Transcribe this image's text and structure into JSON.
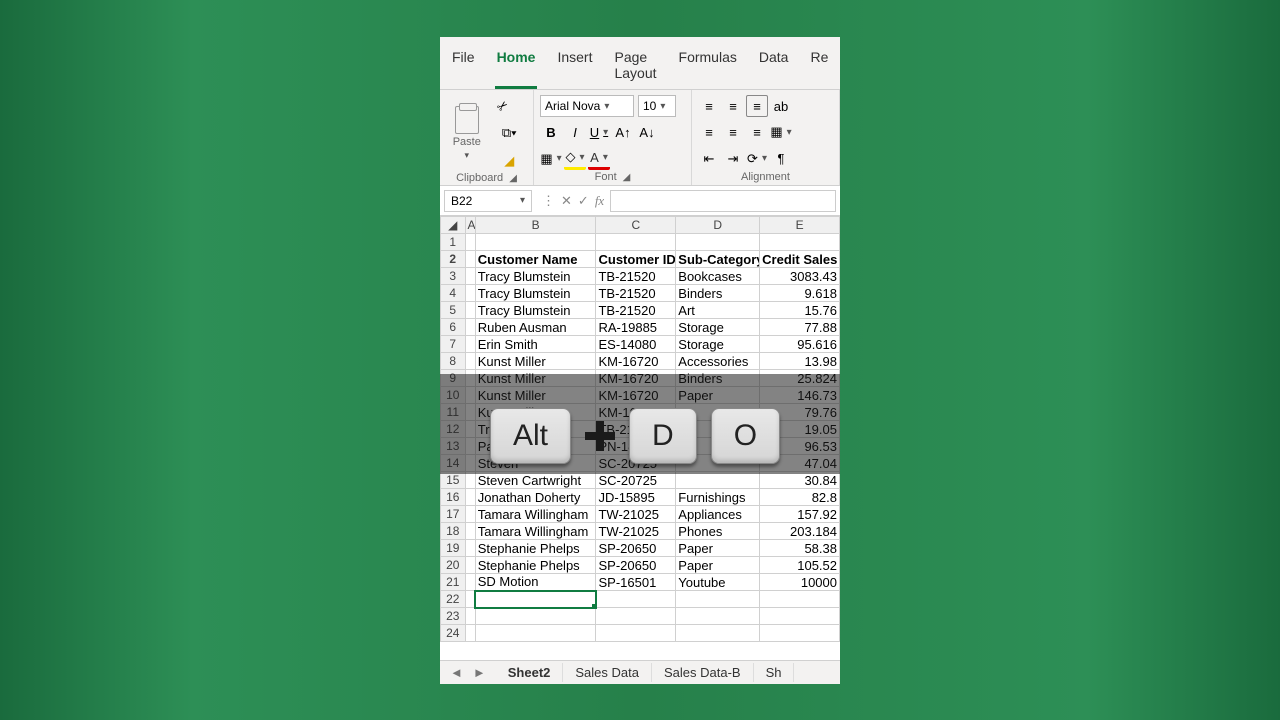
{
  "menu": {
    "items": [
      "File",
      "Home",
      "Insert",
      "Page Layout",
      "Formulas",
      "Data",
      "Re"
    ],
    "active": "Home"
  },
  "clipboard": {
    "paste": "Paste",
    "label": "Clipboard"
  },
  "font": {
    "name": "Arial Nova",
    "size": "10",
    "label": "Font"
  },
  "alignment": {
    "label": "Alignment"
  },
  "nameBox": "B22",
  "columns": [
    "A",
    "B",
    "C",
    "D",
    "E"
  ],
  "headerRow": [
    "",
    "Customer Name",
    "Customer ID",
    "Sub-Category",
    "Credit Sales"
  ],
  "rows": [
    {
      "n": 3,
      "b": "Tracy Blumstein",
      "c": "TB-21520",
      "d": "Bookcases",
      "e": "3083.43"
    },
    {
      "n": 4,
      "b": "Tracy Blumstein",
      "c": "TB-21520",
      "d": "Binders",
      "e": "9.618"
    },
    {
      "n": 5,
      "b": "Tracy Blumstein",
      "c": "TB-21520",
      "d": "Art",
      "e": "15.76"
    },
    {
      "n": 6,
      "b": "Ruben Ausman",
      "c": "RA-19885",
      "d": "Storage",
      "e": "77.88"
    },
    {
      "n": 7,
      "b": "Erin Smith",
      "c": "ES-14080",
      "d": "Storage",
      "e": "95.616"
    },
    {
      "n": 8,
      "b": "Kunst Miller",
      "c": "KM-16720",
      "d": "Accessories",
      "e": "13.98"
    },
    {
      "n": 9,
      "b": "Kunst Miller",
      "c": "KM-16720",
      "d": "Binders",
      "e": "25.824"
    },
    {
      "n": 10,
      "b": "Kunst Miller",
      "c": "KM-16720",
      "d": "Paper",
      "e": "146.73"
    },
    {
      "n": 11,
      "b": "Kunst Miller",
      "c": "KM-16720",
      "d": "",
      "e": "79.76"
    },
    {
      "n": 12,
      "b": "Tracy",
      "c": "TB-21520",
      "d": "",
      "e": "19.05"
    },
    {
      "n": 13,
      "b": "Parh",
      "c": "PN-18775",
      "d": "",
      "e": "96.53"
    },
    {
      "n": 14,
      "b": "Steven",
      "c": "SC-20725",
      "d": "",
      "e": "47.04"
    },
    {
      "n": 15,
      "b": "Steven Cartwright",
      "c": "SC-20725",
      "d": "",
      "e": "30.84"
    },
    {
      "n": 16,
      "b": "Jonathan Doherty",
      "c": "JD-15895",
      "d": "Furnishings",
      "e": "82.8"
    },
    {
      "n": 17,
      "b": "Tamara Willingham",
      "c": "TW-21025",
      "d": "Appliances",
      "e": "157.92"
    },
    {
      "n": 18,
      "b": "Tamara Willingham",
      "c": "TW-21025",
      "d": "Phones",
      "e": "203.184"
    },
    {
      "n": 19,
      "b": "Stephanie Phelps",
      "c": "SP-20650",
      "d": "Paper",
      "e": "58.38"
    },
    {
      "n": 20,
      "b": "Stephanie Phelps",
      "c": "SP-20650",
      "d": "Paper",
      "e": "105.52"
    },
    {
      "n": 21,
      "b": "SD Motion",
      "c": "SP-16501",
      "d": "Youtube",
      "e": "10000"
    }
  ],
  "emptyRows": [
    22,
    23,
    24
  ],
  "selectedRow": 22,
  "sheetTabs": [
    "Sheet2",
    "Sales Data",
    "Sales Data-B",
    "Sh"
  ],
  "keys": [
    "Alt",
    "D",
    "O"
  ]
}
